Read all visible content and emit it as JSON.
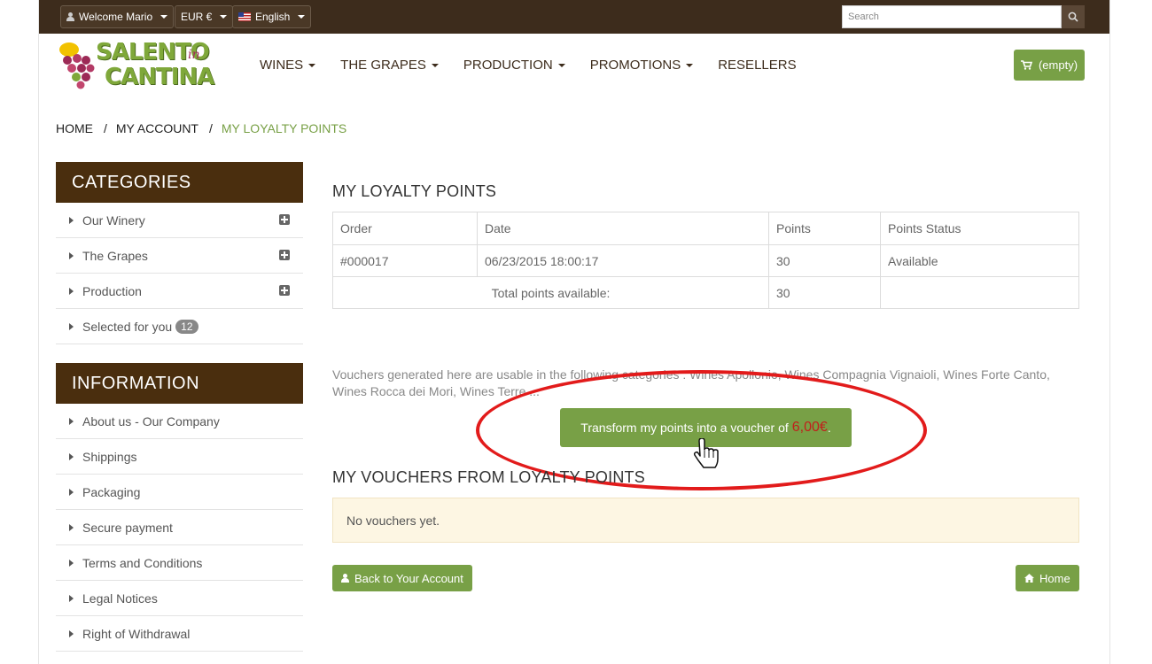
{
  "topbar": {
    "welcome": "Welcome Mario",
    "currency": "EUR €",
    "language": "English",
    "search_placeholder": "Search"
  },
  "logo": {
    "line1": "SALENTO",
    "line2": "CANTINA",
    "in": "in"
  },
  "nav": [
    "WINES",
    "THE GRAPES",
    "PRODUCTION",
    "PROMOTIONS",
    "RESELLERS"
  ],
  "cart": {
    "label": "(empty)"
  },
  "breadcrumb": {
    "home": "HOME",
    "account": "MY ACCOUNT",
    "current": "MY LOYALTY POINTS"
  },
  "categories": {
    "title": "CATEGORIES",
    "items": [
      "Our Winery",
      "The Grapes",
      "Production",
      "Selected for you"
    ],
    "selected_count": "12"
  },
  "information": {
    "title": "INFORMATION",
    "items": [
      "About us - Our Company",
      "Shippings",
      "Packaging",
      "Secure payment",
      "Terms and Conditions",
      "Legal Notices",
      "Right of Withdrawal"
    ]
  },
  "loyalty": {
    "title": "MY LOYALTY POINTS",
    "columns": [
      "Order",
      "Date",
      "Points",
      "Points Status"
    ],
    "row": {
      "order": "#000017",
      "date": "06/23/2015 18:00:17",
      "points": "30",
      "status": "Available"
    },
    "total_label": "Total points available:",
    "total_points": "30",
    "note": "Vouchers generated here are usable in the following categories : Wines Apollonio, Wines Compagnia Vignaioli, Wines Forte Canto, Wines Rocca dei Mori, Wines Terre ...",
    "transform_label": "Transform my points into a voucher of ",
    "transform_amount": "6,00€",
    "transform_suffix": "."
  },
  "vouchers": {
    "title": "MY VOUCHERS FROM LOYALTY POINTS",
    "empty": "No vouchers yet."
  },
  "footer_buttons": {
    "back": "Back to Your Account",
    "home": "Home"
  },
  "colors": {
    "brand_brown": "#4a2e0e",
    "brand_green": "#78a046",
    "highlight_red": "#e21b1b"
  }
}
